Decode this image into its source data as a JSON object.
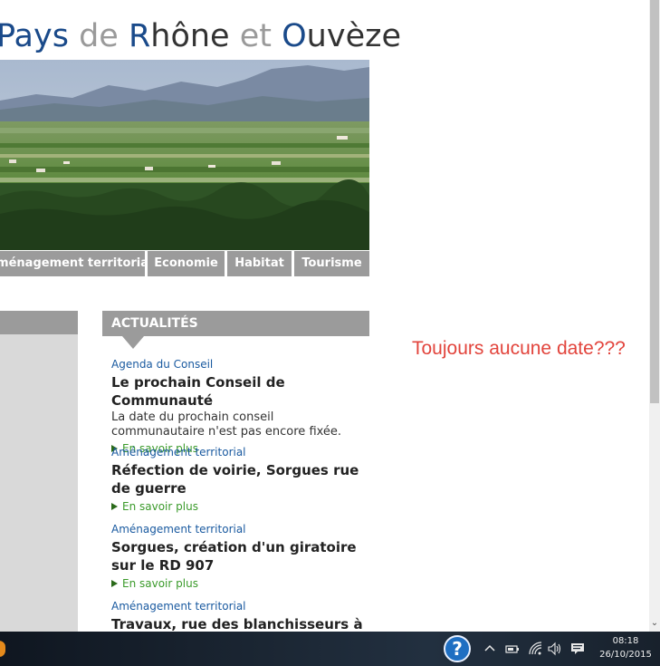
{
  "site": {
    "title_parts": [
      "Pays",
      " de ",
      "R",
      "hône",
      " et ",
      "O",
      "uvèze"
    ]
  },
  "nav": {
    "items": [
      "Aménagement territorial",
      "Economie",
      "Habitat",
      "Tourisme"
    ]
  },
  "news": {
    "header": "ACTUALITÉS",
    "items": [
      {
        "category": "Agenda du Conseil",
        "title": "Le prochain Conseil de Communauté",
        "desc": "La date du prochain conseil communautaire n'est pas encore fixée.",
        "more": "En savoir plus"
      },
      {
        "category": "Aménagement territorial",
        "title": "Réfection de voirie, Sorgues rue de guerre",
        "more": "En savoir plus"
      },
      {
        "category": "Aménagement territorial",
        "title": "Sorgues, création d'un giratoire sur le RD 907",
        "more": "En savoir plus"
      },
      {
        "category": "Aménagement territorial",
        "title": "Travaux, rue des blanchisseurs à"
      }
    ]
  },
  "annotation": "Toujours aucune date???",
  "scrollbar": {
    "down_glyph": "⌄"
  },
  "taskbar": {
    "help_glyph": "?",
    "time": "08:18",
    "date": "26/10/2015",
    "tray_icons": [
      "chevron-up-icon",
      "battery-icon",
      "wifi-icon",
      "volume-icon",
      "notification-icon"
    ]
  },
  "colors": {
    "title_blue": "#1a4a8a",
    "nav_grey": "#9b9b9b",
    "category_blue": "#1a5aa0",
    "more_green": "#3a9a2a",
    "annotation_red": "#e2443c"
  }
}
